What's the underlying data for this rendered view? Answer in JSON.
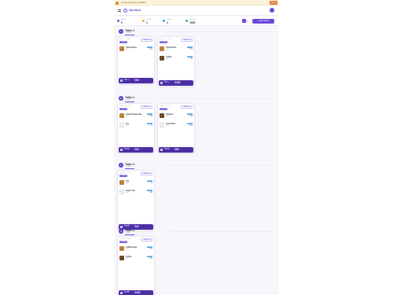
{
  "banner": {
    "text": "Connectivity is unstable",
    "button": "Retry"
  },
  "app": {
    "brand": "Syndicet"
  },
  "stats": [
    {
      "label": "Orders",
      "value": "6",
      "color": "#7b5ce0"
    },
    {
      "label": "Pending",
      "value": "2",
      "color": "#f0a83a"
    },
    {
      "label": "Tables",
      "value": "4",
      "color": "#3b9be8"
    },
    {
      "label": "Revenue",
      "value": "₹808",
      "color": "#2fbf71"
    }
  ],
  "toolbar": {
    "new_order_label": "+ New Order",
    "caret": "▾"
  },
  "tables": [
    {
      "number": "1",
      "name": "Table 1",
      "subtitle": "2 orders",
      "orders": [
        {
          "meta": "Order #1 · 10:02",
          "edit": "+ Add items",
          "status": "Preparing",
          "items": [
            {
              "name": "Chili Paneer",
              "qty": "Qty 1",
              "badge": "Served",
              "price": "₹99",
              "thumb": "food"
            }
          ],
          "pay_label": "Pay",
          "pay_sub": "Settle bill",
          "amount": "₹99"
        },
        {
          "meta": "Order #2 · 10:15",
          "edit": "+ Add items",
          "status": "Preparing",
          "items": [
            {
              "name": "Chili Potato",
              "qty": "Qty 1",
              "badge": "Served",
              "price": "₹90",
              "thumb": "food"
            },
            {
              "name": "Coffee",
              "qty": "Qty 1",
              "badge": "Served",
              "price": "₹40",
              "thumb": "cup"
            }
          ],
          "pay_label": "Pay",
          "pay_sub": "Settle bill",
          "amount": "₹130"
        }
      ]
    },
    {
      "number": "2",
      "name": "Table 2",
      "subtitle": "2 orders",
      "orders": [
        {
          "meta": "Order #3 · 10:21",
          "edit": "+ Add items",
          "status": "Preparing",
          "items": [
            {
              "name": "Fried Chicken Mo..",
              "qty": "Qty 1",
              "badge": "Served",
              "price": "₹40",
              "thumb": "food"
            },
            {
              "name": "Tea",
              "qty": "Qty 1",
              "badge": "Served",
              "price": "₹2",
              "thumb": "placeholder"
            }
          ],
          "pay_label": "Pay bill",
          "pay_sub": "Settle bill",
          "amount": "₹42"
        },
        {
          "meta": "Order #4 · 10:28",
          "edit": "+ Add items",
          "status": "Preparing",
          "items": [
            {
              "name": "Chicken",
              "qty": "Qty 1",
              "badge": "Served",
              "price": "₹40",
              "thumb": "cup"
            },
            {
              "name": "Cold Drink",
              "qty": "Qty 1",
              "badge": "Served",
              "price": "₹50",
              "thumb": "placeholder"
            }
          ],
          "pay_label": "Pay bill",
          "pay_sub": "Settle bill",
          "amount": "₹90"
        }
      ]
    },
    {
      "number": "3",
      "name": "Table 3",
      "subtitle": "1 order",
      "orders": [
        {
          "meta": "Order #5 · 10:40",
          "edit": "+ Add items",
          "status": "Preparing",
          "items": [
            {
              "name": "Tea",
              "qty": "Qty 1",
              "badge": "Served",
              "price": "₹2",
              "thumb": "food"
            },
            {
              "name": "Green Tea",
              "qty": "Qty 1",
              "badge": "Served",
              "price": "₹40",
              "thumb": "placeholder"
            }
          ],
          "pay_label": "Pay bill",
          "pay_sub": "Settle bill",
          "amount": "₹42"
        }
      ]
    },
    {
      "number": "4",
      "name": "Table 4",
      "subtitle": "1 order",
      "orders": [
        {
          "meta": "Order #6 · 10:52",
          "edit": "+ Add items",
          "status": "Preparing",
          "items": [
            {
              "name": "Chilli Paneer",
              "qty": "Qty 1",
              "badge": "Served",
              "price": "₹99",
              "thumb": "food"
            },
            {
              "name": "Coffee",
              "qty": "Qty 1",
              "badge": "Served",
              "price": "₹40",
              "thumb": "cup"
            }
          ],
          "pay_label": "Pay bill",
          "pay_sub": "Settle bill",
          "amount": "₹139"
        }
      ]
    }
  ]
}
